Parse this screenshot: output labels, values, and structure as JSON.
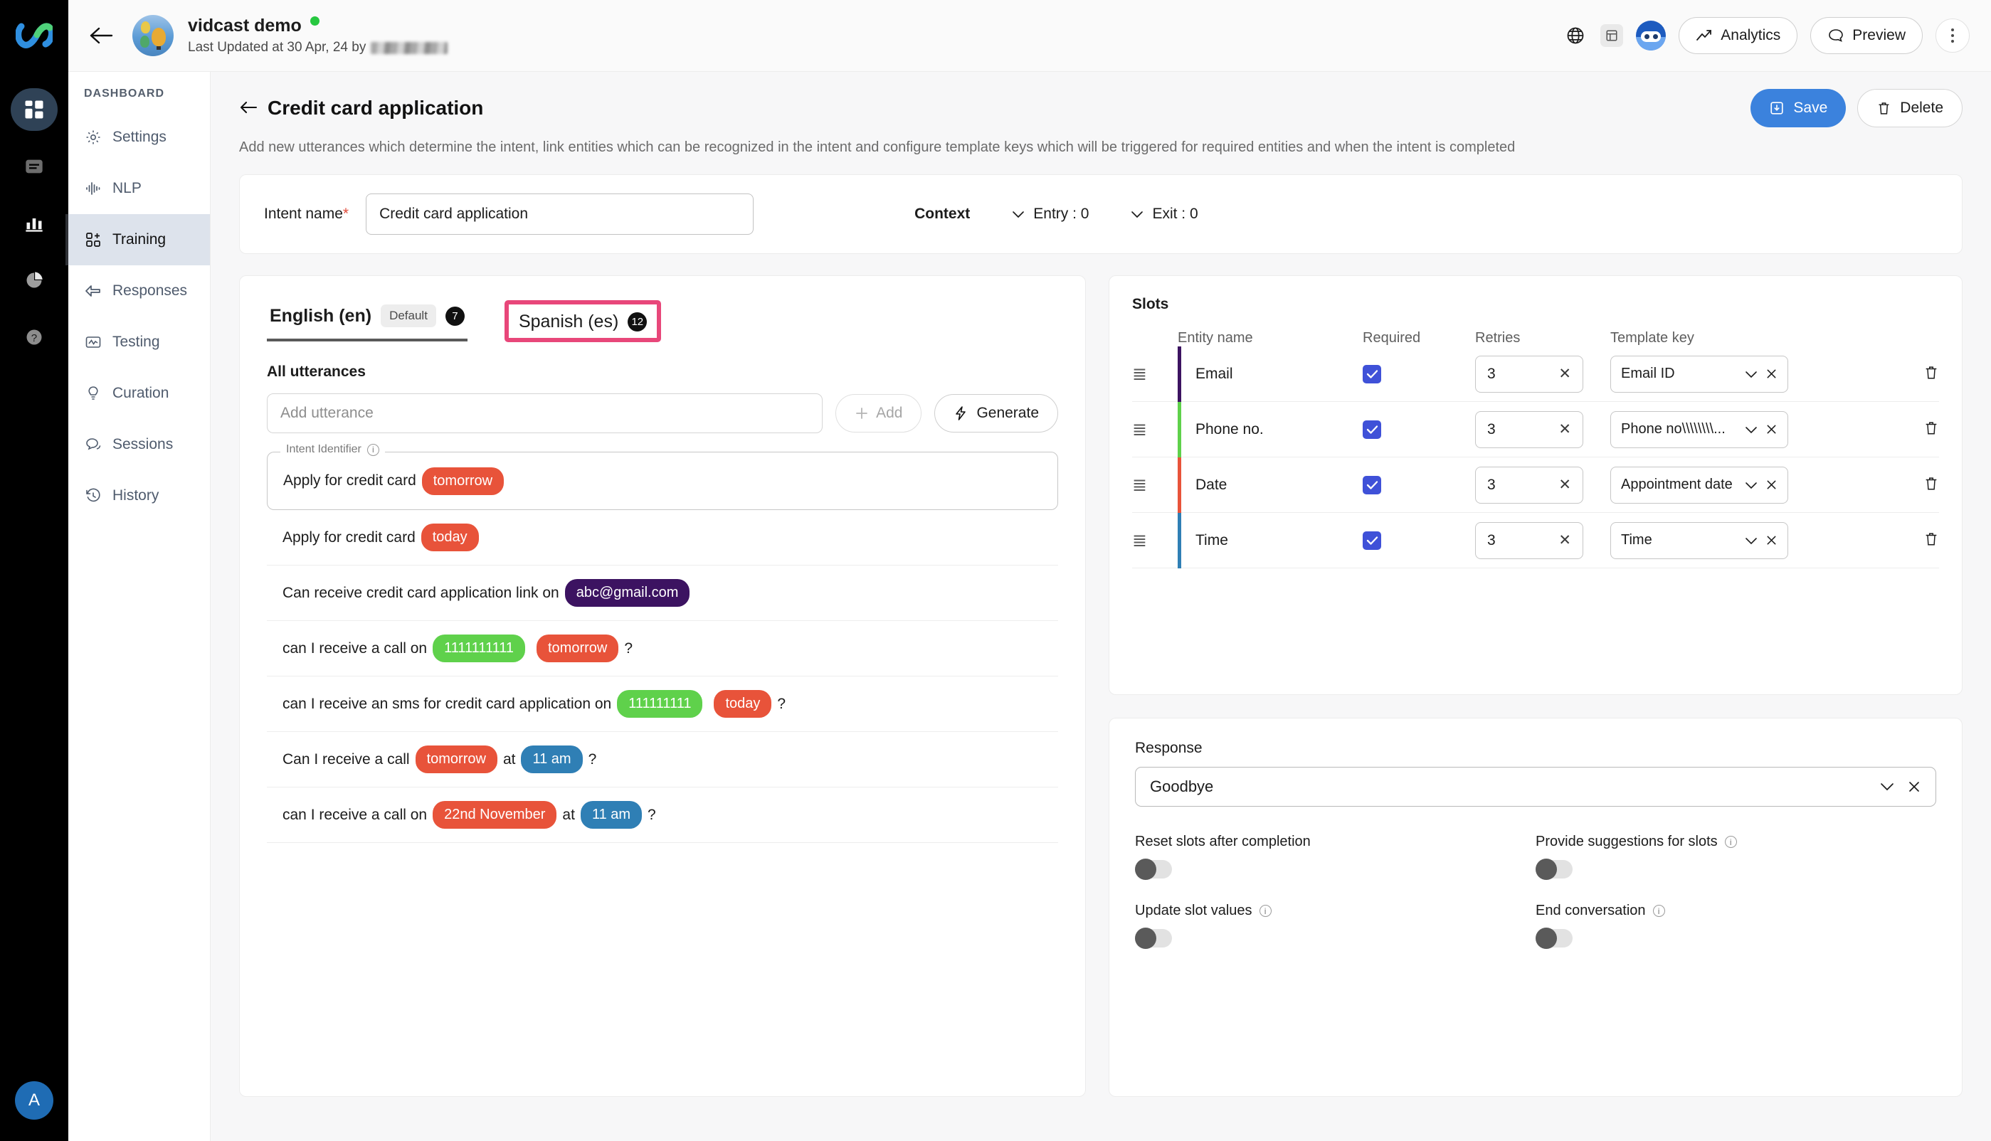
{
  "rail": {
    "logo_icon": "infinity-logo-icon",
    "items": [
      {
        "icon": "dashboard-grid-icon",
        "active": true
      },
      {
        "icon": "document-lines-icon",
        "active": false
      },
      {
        "icon": "bar-chart-icon",
        "active": false
      },
      {
        "icon": "pie-chart-icon",
        "active": false
      },
      {
        "icon": "help-question-icon",
        "active": false
      }
    ],
    "avatar_initial": "A"
  },
  "topbar": {
    "back_icon": "back-arrow-icon",
    "brand_name": "vidcast demo",
    "status": "online",
    "last_updated_prefix": "Last Updated at 30 Apr, 24 by",
    "globe_icon": "globe-icon",
    "layout_icon": "layout-panel-icon",
    "profile_icon": "ninja-avatar-icon",
    "analytics_label": "Analytics",
    "analytics_icon": "trend-up-icon",
    "preview_label": "Preview",
    "preview_icon": "chat-bubble-icon",
    "more_icon": "kebab-menu-icon"
  },
  "sidebar": {
    "section_title": "DASHBOARD",
    "items": [
      {
        "label": "Settings",
        "icon": "gear-icon",
        "active": false
      },
      {
        "label": "NLP",
        "icon": "waveform-icon",
        "active": false
      },
      {
        "label": "Training",
        "icon": "training-add-icon",
        "active": true
      },
      {
        "label": "Responses",
        "icon": "reply-arrow-icon",
        "active": false
      },
      {
        "label": "Testing",
        "icon": "monitor-wave-icon",
        "active": false
      },
      {
        "label": "Curation",
        "icon": "lightbulb-icon",
        "active": false
      },
      {
        "label": "Sessions",
        "icon": "chat-dots-icon",
        "active": false
      },
      {
        "label": "History",
        "icon": "clock-back-icon",
        "active": false
      }
    ]
  },
  "page_header": {
    "back_icon": "back-arrow-icon",
    "title": "Credit card application",
    "description": "Add new utterances which determine the intent, link entities which can be recognized in the intent and configure template keys which will be triggered for required entities and when the intent is completed",
    "save_label": "Save",
    "save_icon": "save-download-icon",
    "delete_label": "Delete",
    "delete_icon": "trash-icon"
  },
  "intent_bar": {
    "label": "Intent name",
    "required_mark": "*",
    "value": "Credit card application",
    "placeholder": "Intent name",
    "context_label": "Context",
    "entry_label": "Entry : 0",
    "exit_label": "Exit : 0",
    "chevron_icon": "chevron-down-icon"
  },
  "utterances_panel": {
    "tabs": [
      {
        "name": "English  (en)",
        "chip": "Default",
        "count": "7",
        "selected": true,
        "highlighted": false
      },
      {
        "name": "Spanish  (es)",
        "chip": null,
        "count": "12",
        "selected": false,
        "highlighted": true
      }
    ],
    "highlight_color": "#e8477a",
    "section_title": "All utterances",
    "input_placeholder": "Add utterance",
    "input_value": "",
    "add_label": "Add",
    "add_icon": "plus-icon",
    "generate_label": "Generate",
    "generate_icon": "lightning-bolt-icon",
    "intent_identifier_legend": "Intent Identifier",
    "info_icon": "info-circle-icon",
    "entity_colors": {
      "date": "#e8533a",
      "email": "#3c1361",
      "phone": "#5fd14b",
      "time": "#2f7fb5"
    },
    "items": [
      {
        "is_identifier": true,
        "parts": [
          {
            "type": "text",
            "value": "Apply for credit card"
          },
          {
            "type": "entity",
            "value": "tomorrow",
            "color": "#e8533a"
          }
        ]
      },
      {
        "is_identifier": false,
        "parts": [
          {
            "type": "text",
            "value": "Apply for credit card"
          },
          {
            "type": "entity",
            "value": "today",
            "color": "#e8533a"
          }
        ]
      },
      {
        "is_identifier": false,
        "parts": [
          {
            "type": "text",
            "value": "Can receive credit card application link on"
          },
          {
            "type": "entity",
            "value": "abc@gmail.com",
            "color": "#3c1361"
          }
        ]
      },
      {
        "is_identifier": false,
        "parts": [
          {
            "type": "text",
            "value": "can I receive a call on"
          },
          {
            "type": "entity",
            "value": "1111111111",
            "color": "#5fd14b"
          },
          {
            "type": "entity",
            "value": "tomorrow",
            "color": "#e8533a"
          },
          {
            "type": "text",
            "value": "?"
          }
        ]
      },
      {
        "is_identifier": false,
        "parts": [
          {
            "type": "text",
            "value": "can I receive an sms for credit card application on"
          },
          {
            "type": "entity",
            "value": "111111111",
            "color": "#5fd14b"
          },
          {
            "type": "entity",
            "value": "today",
            "color": "#e8533a"
          },
          {
            "type": "text",
            "value": "?"
          }
        ]
      },
      {
        "is_identifier": false,
        "parts": [
          {
            "type": "text",
            "value": "Can I receive a call"
          },
          {
            "type": "entity",
            "value": "tomorrow",
            "color": "#e8533a"
          },
          {
            "type": "text",
            "value": "at"
          },
          {
            "type": "entity",
            "value": "11 am",
            "color": "#2f7fb5"
          },
          {
            "type": "text",
            "value": "?"
          }
        ]
      },
      {
        "is_identifier": false,
        "parts": [
          {
            "type": "text",
            "value": "can I receive a call on"
          },
          {
            "type": "entity",
            "value": "22nd November",
            "color": "#e8533a"
          },
          {
            "type": "text",
            "value": "at"
          },
          {
            "type": "entity",
            "value": "11 am",
            "color": "#2f7fb5"
          },
          {
            "type": "text",
            "value": "?"
          }
        ]
      }
    ]
  },
  "slots_panel": {
    "title": "Slots",
    "columns": {
      "entity_name": "Entity name",
      "required": "Required",
      "retries": "Retries",
      "template_key": "Template key"
    },
    "grip_icon": "drag-handle-icon",
    "chevron_icon": "chevron-down-icon",
    "clear_icon": "clear-x-icon",
    "delete_icon": "trash-icon",
    "rows": [
      {
        "entity": "Email",
        "color": "#3c1361",
        "required": true,
        "retries": "3",
        "template_key": "Email ID"
      },
      {
        "entity": "Phone no.",
        "color": "#5fd14b",
        "required": true,
        "retries": "3",
        "template_key": "Phone no\\\\\\\\\\\\\\\\..."
      },
      {
        "entity": "Date",
        "color": "#e8533a",
        "required": true,
        "retries": "3",
        "template_key": "Appointment date"
      },
      {
        "entity": "Time",
        "color": "#2f7fb5",
        "required": true,
        "retries": "3",
        "template_key": "Time"
      }
    ]
  },
  "response_panel": {
    "label": "Response",
    "value": "Goodbye",
    "chevron_icon": "chevron-down-icon",
    "clear_icon": "clear-x-icon",
    "toggles": [
      {
        "label": "Reset slots after completion",
        "has_info": false,
        "on": false
      },
      {
        "label": "Provide suggestions for slots",
        "has_info": true,
        "on": false
      },
      {
        "label": "Update slot values",
        "has_info": true,
        "on": false
      },
      {
        "label": "End conversation",
        "has_info": true,
        "on": false
      }
    ]
  }
}
